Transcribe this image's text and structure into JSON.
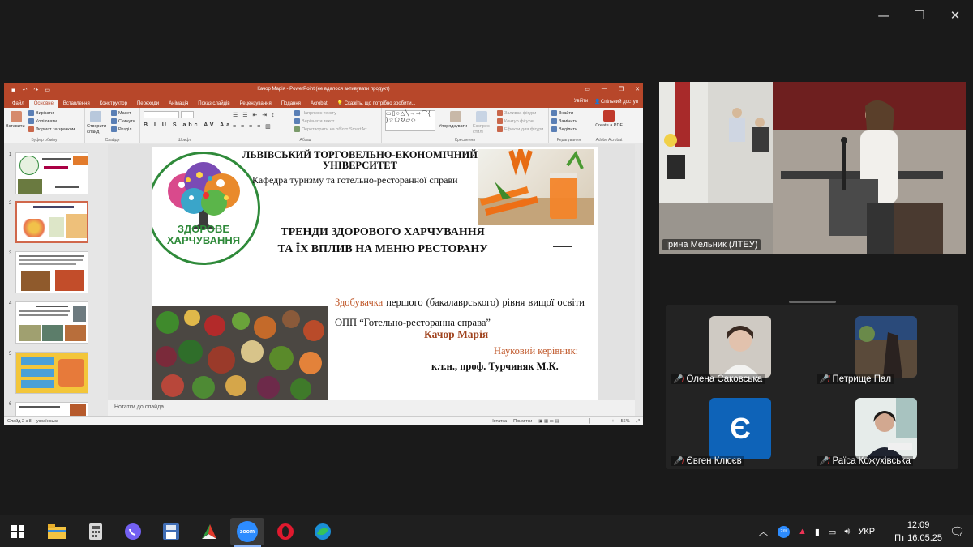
{
  "window_controls": {
    "minimize": "—",
    "restore": "❐",
    "close": "✕"
  },
  "ppt": {
    "title": "Качор Марія - PowerPoint (не вдалося активувати продукт)",
    "tabs": [
      "Файл",
      "Основне",
      "Вставлення",
      "Конструктор",
      "Переходи",
      "Анімація",
      "Показ слайдів",
      "Рецензування",
      "Подання",
      "Acrobat"
    ],
    "tell_me": "Скажіть, що потрібно зробити...",
    "sign_in": "Увійти",
    "share": "Спільний доступ",
    "ribbon": {
      "paste": "Вставити",
      "cut": "Вирізати",
      "copy": "Копіювати",
      "format_painter": "Формат за зразком",
      "clipboard_group": "Буфер обміну",
      "new_slide": "Створити слайд",
      "layout": "Макет",
      "reset": "Скинути",
      "section": "Розділ",
      "slides_group": "Слайди",
      "font_group": "Шрифт",
      "text_direction": "Напрямок тексту",
      "align_text": "Вирівняти текст",
      "smartart": "Перетворити на об'єкт SmartArt",
      "paragraph_group": "Абзац",
      "arrange": "Упорядкувати",
      "quick_styles": "Експрес-стилі",
      "shape_fill": "Заливка фігури",
      "shape_outline": "Контур фігури",
      "shape_effects": "Ефекти для фігури",
      "drawing_group": "Креслення",
      "find": "Знайти",
      "replace": "Замінити",
      "select": "Виділити",
      "editing_group": "Редагування",
      "create_pdf": "Create a PDF",
      "acrobat_group": "Adobe Acrobat"
    },
    "notes_placeholder": "Нотатки до слайда",
    "status_left": "Слайд 2 з 8",
    "status_lang": "українська",
    "status_notes": "Нотатка",
    "status_comments": "Примітки",
    "zoom": "56%"
  },
  "slide": {
    "university": "ЛЬВІВСЬКИЙ ТОРГОВЕЛЬНО-ЕКОНОМІЧНИЙ УНІВЕРСИТЕТ",
    "department": "Кафедра туризму та готельно-ресторанної справи",
    "logo_text": "ЗДОРОВЕ ХАРЧУВАННЯ",
    "title": "ТРЕНДИ ЗДОРОВОГО ХАРЧУВАННЯ ТА ЇХ ВПЛИВ НА МЕНЮ РЕСТОРАНУ",
    "student_lead": "Здобувачка",
    "student_text": "першого (бакалаврського) рівня вищої освіти ОПП “Готельно-ресторанна справа”",
    "student_name": "Качор Марія",
    "supervisor_label": "Науковий керівник:",
    "supervisor": "к.т.н., проф. Турчиняк М.К."
  },
  "thumbnails": [
    {
      "num": "1"
    },
    {
      "num": "2"
    },
    {
      "num": "3"
    },
    {
      "num": "4"
    },
    {
      "num": "5"
    },
    {
      "num": "6"
    }
  ],
  "zoom_meeting": {
    "speaker": "Ірина Мельник  (ЛТЕУ)",
    "participants": [
      {
        "name": "Олена Саковська",
        "muted": true
      },
      {
        "name": "Петрище Пал",
        "muted": true
      },
      {
        "name": "Євген Клюєв",
        "muted": true,
        "initial": "Є"
      },
      {
        "name": "Раїса Кожухівська",
        "muted": true
      }
    ]
  },
  "taskbar": {
    "lang": "УКР",
    "time": "12:09",
    "date": "Пт 16.05.25",
    "zoom_label": "zoom"
  }
}
